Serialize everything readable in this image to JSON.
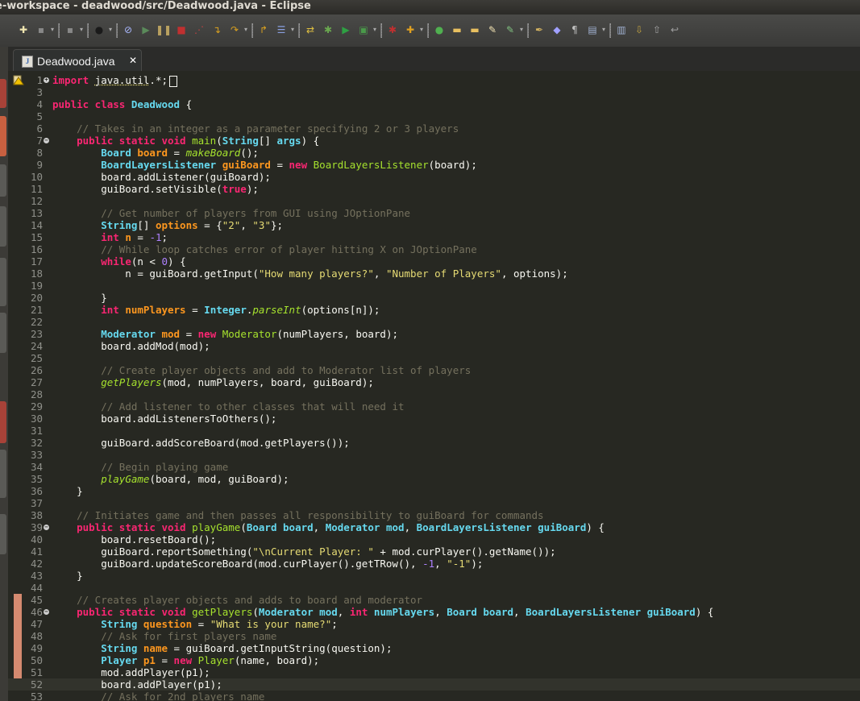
{
  "window": {
    "title": "e-workspace - deadwood/src/Deadwood.java - Eclipse"
  },
  "toolbar": {
    "buttons": [
      {
        "name": "new-icon",
        "glyph": "✚",
        "color": "#f0e6b0"
      },
      {
        "name": "save-icon",
        "glyph": "▪",
        "color": "#888888"
      },
      {
        "name": "save-all-icon",
        "glyph": "▪",
        "color": "#888888"
      },
      {
        "name": "team-icon",
        "glyph": "●",
        "color": "#1a1a1a"
      },
      {
        "name": "skip-breakpoints-icon",
        "glyph": "⊘",
        "color": "#aab8ff"
      },
      {
        "name": "resume-icon",
        "glyph": "▶",
        "color": "#5a8a5a"
      },
      {
        "name": "suspend-icon",
        "glyph": "❚❚",
        "color": "#b8a060"
      },
      {
        "name": "terminate-icon",
        "glyph": "■",
        "color": "#c03030"
      },
      {
        "name": "disconnect-icon",
        "glyph": "⋰",
        "color": "#c04040"
      },
      {
        "name": "step-into-icon",
        "glyph": "↴",
        "color": "#d8a020"
      },
      {
        "name": "step-over-icon",
        "glyph": "↷",
        "color": "#d8a020"
      },
      {
        "name": "step-return-icon",
        "glyph": "↱",
        "color": "#d8a020"
      },
      {
        "name": "drop-to-frame-icon",
        "glyph": "☰",
        "color": "#8aa0e0"
      },
      {
        "name": "use-step-filters-icon",
        "glyph": "⇄",
        "color": "#e0c040"
      },
      {
        "name": "debug-icon",
        "glyph": "✱",
        "color": "#6aa84f"
      },
      {
        "name": "run-icon",
        "glyph": "▶",
        "color": "#2ea043"
      },
      {
        "name": "coverage-icon",
        "glyph": "▣",
        "color": "#4a9a4a"
      },
      {
        "name": "external-tools-icon",
        "glyph": "✱",
        "color": "#c03030"
      },
      {
        "name": "new-java-project-icon",
        "glyph": "✚",
        "color": "#e0a020"
      },
      {
        "name": "new-class-icon",
        "glyph": "●",
        "color": "#50b050"
      },
      {
        "name": "open-folder-icon",
        "glyph": "▬",
        "color": "#e8c060"
      },
      {
        "name": "open-type-icon",
        "glyph": "▬",
        "color": "#e8c060"
      },
      {
        "name": "search-icon",
        "glyph": "✎",
        "color": "#f0e0b0"
      },
      {
        "name": "annotation-icon",
        "glyph": "✎",
        "color": "#80c080"
      },
      {
        "name": "pen-icon",
        "glyph": "✒",
        "color": "#d0b060"
      },
      {
        "name": "toggle-mark-icon",
        "glyph": "◆",
        "color": "#a0a0ff"
      },
      {
        "name": "show-whitespace-icon",
        "glyph": "¶",
        "color": "#c0c0c0"
      },
      {
        "name": "block-selection-icon",
        "glyph": "▤",
        "color": "#a0b0d0"
      },
      {
        "name": "format-icon",
        "glyph": "▥",
        "color": "#a0b0d0"
      },
      {
        "name": "next-annotation-icon",
        "glyph": "⇩",
        "color": "#c0a040"
      },
      {
        "name": "prev-annotation-icon",
        "glyph": "⇧",
        "color": "#a0a0a0"
      },
      {
        "name": "last-edit-icon",
        "glyph": "↩",
        "color": "#a0a0a0"
      }
    ]
  },
  "editor": {
    "tab": {
      "label": "Deadwood.java",
      "close": "✕",
      "file_icon": "J"
    },
    "current_line": 52,
    "marker_lines": [
      45,
      46,
      47,
      48,
      49,
      50,
      51,
      52
    ],
    "lines": [
      {
        "n": "1",
        "fold": "+",
        "tokens": [
          [
            "kw",
            "import "
          ],
          [
            "ul",
            "java.util"
          ],
          [
            "p",
            ".*;"
          ]
        ],
        "cursor": true
      },
      {
        "n": "3",
        "tokens": []
      },
      {
        "n": "4",
        "tokens": [
          [
            "kw",
            "public class "
          ],
          [
            "ty",
            "Deadwood"
          ],
          [
            "p",
            " {"
          ]
        ]
      },
      {
        "n": "5",
        "tokens": []
      },
      {
        "n": "6",
        "tokens": [
          [
            "p",
            "    "
          ],
          [
            "cm",
            "// Takes in an integer as a parameter specifying 2 or 3 players"
          ]
        ]
      },
      {
        "n": "7",
        "fold": "−",
        "tokens": [
          [
            "p",
            "    "
          ],
          [
            "kw",
            "public static void "
          ],
          [
            "cls",
            "main"
          ],
          [
            "p",
            "("
          ],
          [
            "ty",
            "String"
          ],
          [
            "p",
            "[] "
          ],
          [
            "ty",
            "args"
          ],
          [
            "p",
            ") {"
          ]
        ]
      },
      {
        "n": "8",
        "tokens": [
          [
            "p",
            "        "
          ],
          [
            "ty",
            "Board "
          ],
          [
            "var",
            "board"
          ],
          [
            "p",
            " = "
          ],
          [
            "fn",
            "makeBoard"
          ],
          [
            "p",
            "();"
          ]
        ]
      },
      {
        "n": "9",
        "tokens": [
          [
            "p",
            "        "
          ],
          [
            "ty",
            "BoardLayersListener "
          ],
          [
            "var",
            "guiBoard"
          ],
          [
            "p",
            " = "
          ],
          [
            "kw",
            "new "
          ],
          [
            "cls",
            "BoardLayersListener"
          ],
          [
            "p",
            "(board);"
          ]
        ]
      },
      {
        "n": "10",
        "tokens": [
          [
            "p",
            "        board.addListener(guiBoard);"
          ]
        ]
      },
      {
        "n": "11",
        "tokens": [
          [
            "p",
            "        guiBoard.setVisible("
          ],
          [
            "kw",
            "true"
          ],
          [
            "p",
            ");"
          ]
        ]
      },
      {
        "n": "12",
        "tokens": []
      },
      {
        "n": "13",
        "tokens": [
          [
            "p",
            "        "
          ],
          [
            "cm",
            "// Get number of players from GUI using JOptionPane"
          ]
        ]
      },
      {
        "n": "14",
        "tokens": [
          [
            "p",
            "        "
          ],
          [
            "ty",
            "String"
          ],
          [
            "p",
            "[] "
          ],
          [
            "var",
            "options"
          ],
          [
            "p",
            " = {"
          ],
          [
            "str",
            "\"2\""
          ],
          [
            "p",
            ", "
          ],
          [
            "str",
            "\"3\""
          ],
          [
            "p",
            "};"
          ]
        ]
      },
      {
        "n": "15",
        "tokens": [
          [
            "p",
            "        "
          ],
          [
            "kw",
            "int "
          ],
          [
            "var",
            "n"
          ],
          [
            "p",
            " = "
          ],
          [
            "num",
            "-1"
          ],
          [
            "p",
            ";"
          ]
        ]
      },
      {
        "n": "16",
        "tokens": [
          [
            "p",
            "        "
          ],
          [
            "cm",
            "// While loop catches error of player hitting X on JOptionPane"
          ]
        ]
      },
      {
        "n": "17",
        "tokens": [
          [
            "p",
            "        "
          ],
          [
            "kw",
            "while"
          ],
          [
            "p",
            "(n < "
          ],
          [
            "num",
            "0"
          ],
          [
            "p",
            ") {"
          ]
        ]
      },
      {
        "n": "18",
        "tokens": [
          [
            "p",
            "            n = guiBoard.getInput("
          ],
          [
            "str",
            "\"How many players?\""
          ],
          [
            "p",
            ", "
          ],
          [
            "str",
            "\"Number of Players\""
          ],
          [
            "p",
            ", options);"
          ]
        ]
      },
      {
        "n": "19",
        "tokens": []
      },
      {
        "n": "20",
        "tokens": [
          [
            "p",
            "        }"
          ]
        ]
      },
      {
        "n": "21",
        "tokens": [
          [
            "p",
            "        "
          ],
          [
            "kw",
            "int "
          ],
          [
            "var",
            "numPlayers"
          ],
          [
            "p",
            " = "
          ],
          [
            "ty",
            "Integer"
          ],
          [
            "p",
            "."
          ],
          [
            "fn",
            "parseInt"
          ],
          [
            "p",
            "(options[n]);"
          ]
        ]
      },
      {
        "n": "22",
        "tokens": []
      },
      {
        "n": "23",
        "tokens": [
          [
            "p",
            "        "
          ],
          [
            "ty",
            "Moderator "
          ],
          [
            "var",
            "mod"
          ],
          [
            "p",
            " = "
          ],
          [
            "kw",
            "new "
          ],
          [
            "cls",
            "Moderator"
          ],
          [
            "p",
            "(numPlayers, board);"
          ]
        ]
      },
      {
        "n": "24",
        "tokens": [
          [
            "p",
            "        board.addMod(mod);"
          ]
        ]
      },
      {
        "n": "25",
        "tokens": []
      },
      {
        "n": "26",
        "tokens": [
          [
            "p",
            "        "
          ],
          [
            "cm",
            "// Create player objects and add to Moderator list of players"
          ]
        ]
      },
      {
        "n": "27",
        "tokens": [
          [
            "p",
            "        "
          ],
          [
            "fn",
            "getPlayers"
          ],
          [
            "p",
            "(mod, numPlayers, board, guiBoard);"
          ]
        ]
      },
      {
        "n": "28",
        "tokens": []
      },
      {
        "n": "29",
        "tokens": [
          [
            "p",
            "        "
          ],
          [
            "cm",
            "// Add listener to other classes that will need it"
          ]
        ]
      },
      {
        "n": "30",
        "tokens": [
          [
            "p",
            "        board.addListenersToOthers();"
          ]
        ]
      },
      {
        "n": "31",
        "tokens": []
      },
      {
        "n": "32",
        "tokens": [
          [
            "p",
            "        guiBoard.addScoreBoard(mod.getPlayers());"
          ]
        ]
      },
      {
        "n": "33",
        "tokens": []
      },
      {
        "n": "34",
        "tokens": [
          [
            "p",
            "        "
          ],
          [
            "cm",
            "// Begin playing game"
          ]
        ]
      },
      {
        "n": "35",
        "tokens": [
          [
            "p",
            "        "
          ],
          [
            "fn",
            "playGame"
          ],
          [
            "p",
            "(board, mod, guiBoard);"
          ]
        ]
      },
      {
        "n": "36",
        "tokens": [
          [
            "p",
            "    }"
          ]
        ]
      },
      {
        "n": "37",
        "tokens": []
      },
      {
        "n": "38",
        "tokens": [
          [
            "p",
            "    "
          ],
          [
            "cm",
            "// Initiates game and then passes all responsibility to guiBoard for commands"
          ]
        ]
      },
      {
        "n": "39",
        "fold": "−",
        "tokens": [
          [
            "p",
            "    "
          ],
          [
            "kw",
            "public static void "
          ],
          [
            "cls",
            "playGame"
          ],
          [
            "p",
            "("
          ],
          [
            "ty",
            "Board "
          ],
          [
            "ty",
            "board"
          ],
          [
            "p",
            ", "
          ],
          [
            "ty",
            "Moderator "
          ],
          [
            "ty",
            "mod"
          ],
          [
            "p",
            ", "
          ],
          [
            "ty",
            "BoardLayersListener "
          ],
          [
            "ty",
            "guiBoard"
          ],
          [
            "p",
            ") {"
          ]
        ]
      },
      {
        "n": "40",
        "tokens": [
          [
            "p",
            "        board.resetBoard();"
          ]
        ]
      },
      {
        "n": "41",
        "tokens": [
          [
            "p",
            "        guiBoard.reportSomething("
          ],
          [
            "str",
            "\"\\nCurrent Player: \""
          ],
          [
            "p",
            " + mod.curPlayer().getName());"
          ]
        ]
      },
      {
        "n": "42",
        "tokens": [
          [
            "p",
            "        guiBoard.updateScoreBoard(mod.curPlayer().getTRow(), "
          ],
          [
            "num",
            "-1"
          ],
          [
            "p",
            ", "
          ],
          [
            "str",
            "\"-1\""
          ],
          [
            "p",
            ");"
          ]
        ]
      },
      {
        "n": "43",
        "tokens": [
          [
            "p",
            "    }"
          ]
        ]
      },
      {
        "n": "44",
        "tokens": []
      },
      {
        "n": "45",
        "tokens": [
          [
            "p",
            "    "
          ],
          [
            "cm",
            "// Creates player objects and adds to board and moderator"
          ]
        ]
      },
      {
        "n": "46",
        "fold": "−",
        "tokens": [
          [
            "p",
            "    "
          ],
          [
            "kw",
            "public static void "
          ],
          [
            "cls",
            "getPlayers"
          ],
          [
            "p",
            "("
          ],
          [
            "ty",
            "Moderator "
          ],
          [
            "ty",
            "mod"
          ],
          [
            "p",
            ", "
          ],
          [
            "kw",
            "int "
          ],
          [
            "ty",
            "numPlayers"
          ],
          [
            "p",
            ", "
          ],
          [
            "ty",
            "Board "
          ],
          [
            "ty",
            "board"
          ],
          [
            "p",
            ", "
          ],
          [
            "ty",
            "BoardLayersListener "
          ],
          [
            "ty",
            "guiBoard"
          ],
          [
            "p",
            ") {"
          ]
        ]
      },
      {
        "n": "47",
        "tokens": [
          [
            "p",
            "        "
          ],
          [
            "ty",
            "String "
          ],
          [
            "var",
            "question"
          ],
          [
            "p",
            " = "
          ],
          [
            "str",
            "\"What is your name?\""
          ],
          [
            "p",
            ";"
          ]
        ]
      },
      {
        "n": "48",
        "tokens": [
          [
            "p",
            "        "
          ],
          [
            "cm",
            "// Ask for first players name"
          ]
        ]
      },
      {
        "n": "49",
        "tokens": [
          [
            "p",
            "        "
          ],
          [
            "ty",
            "String "
          ],
          [
            "var",
            "name"
          ],
          [
            "p",
            " = "
          ],
          [
            "p",
            "guiBoard.getInputString(question);"
          ]
        ]
      },
      {
        "n": "50",
        "tokens": [
          [
            "p",
            "        "
          ],
          [
            "ty",
            "Player "
          ],
          [
            "var",
            "p1"
          ],
          [
            "p",
            " = "
          ],
          [
            "kw",
            "new "
          ],
          [
            "cls",
            "Player"
          ],
          [
            "p",
            "(name, board);"
          ]
        ]
      },
      {
        "n": "51",
        "tokens": [
          [
            "p",
            "        mod.addPlayer(p1);"
          ]
        ]
      },
      {
        "n": "52",
        "tokens": [
          [
            "p",
            "        board.addPlayer(p1);"
          ]
        ]
      },
      {
        "n": "53",
        "tokens": [
          [
            "p",
            "        "
          ],
          [
            "cm",
            "// Ask for 2nd players name"
          ]
        ]
      }
    ]
  }
}
